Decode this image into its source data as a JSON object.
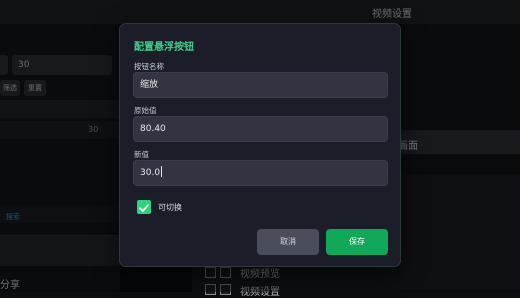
{
  "background": {
    "header_title": "视频设置",
    "left_value": "30",
    "filter_button": "筛选",
    "reset_button": "重置",
    "row_value": "30",
    "search_label": "搜索",
    "bottom_left_text": "分享",
    "right_panel_text": "画面",
    "list_item_1": "视频预览",
    "list_item_2": "视频设置"
  },
  "dialog": {
    "title": "配置悬浮按钮",
    "fields": [
      {
        "label": "按钮名称",
        "value": "缩放"
      },
      {
        "label": "原始值",
        "value": "80.40"
      },
      {
        "label": "新值",
        "value": "30.0"
      }
    ],
    "toggle": {
      "label": "可切换",
      "checked": true
    },
    "cancel_label": "取消",
    "save_label": "保存"
  },
  "colors": {
    "accent": "#3ed08a",
    "save": "#11a85a",
    "checkbox": "#2fd37e",
    "dialog_bg": "#1b1d29",
    "field_bg": "#323541"
  },
  "icons": {
    "checkbox": "check-icon"
  }
}
